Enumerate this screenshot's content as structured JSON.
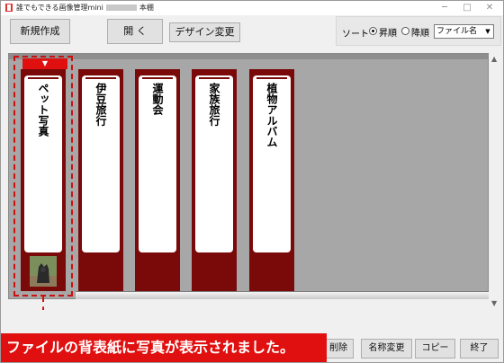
{
  "window": {
    "title_prefix": "誰でもできる画像管理mini",
    "title_suffix": "本棚",
    "controls": [
      "─",
      "□",
      "✕"
    ]
  },
  "toolbar": {
    "new_label": "新規作成",
    "open_label": "開 く",
    "design_label": "デザイン変更"
  },
  "sort": {
    "label": "ソート",
    "asc_label": "昇順",
    "desc_label": "降順",
    "selected": "asc",
    "field_value": "ファイル名"
  },
  "binders": [
    {
      "title": "ペット写真",
      "has_photo": true
    },
    {
      "title": "伊豆旅行",
      "has_photo": false
    },
    {
      "title": "運動会",
      "has_photo": false
    },
    {
      "title": "家族旅行",
      "has_photo": false
    },
    {
      "title": "植物アルバム",
      "has_photo": false
    }
  ],
  "bottom_buttons": {
    "delete_label": "削除",
    "rename_label": "名称変更",
    "copy_label": "コピー",
    "exit_label": "終了"
  },
  "callout": {
    "text": "ファイルの背表紙に写真が表示されました。"
  },
  "colors": {
    "binder": "#7a0a0a",
    "highlight": "#e11010",
    "shelf": "#a7a7a7"
  }
}
